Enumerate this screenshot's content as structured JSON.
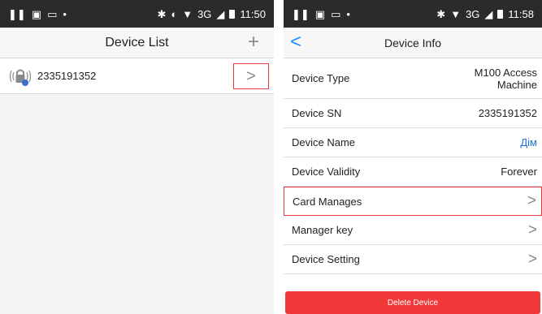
{
  "left_screen": {
    "status": {
      "time": "11:50",
      "network": "3G"
    },
    "title": "Device List",
    "add_symbol": "+",
    "device": {
      "sn": "2335191352",
      "chevron": ">"
    }
  },
  "right_screen": {
    "status": {
      "time": "11:58",
      "network": "3G"
    },
    "title": "Device Info",
    "back_symbol": "<",
    "rows": [
      {
        "label": "Device Type",
        "value": "M100 Access Machine"
      },
      {
        "label": "Device SN",
        "value": "2335191352"
      },
      {
        "label": "Device Name",
        "value": "Дім"
      },
      {
        "label": "Device Validity",
        "value": "Forever"
      },
      {
        "label": "Card Manages",
        "chevron": ">"
      },
      {
        "label": "Manager key",
        "chevron": ">"
      },
      {
        "label": "Device Setting",
        "chevron": ">"
      }
    ],
    "delete_label": "Delete Device"
  },
  "colors": {
    "accent_blue": "#1e90ff",
    "delete_red": "#f2393a",
    "highlight_red": "#e03a3a"
  }
}
